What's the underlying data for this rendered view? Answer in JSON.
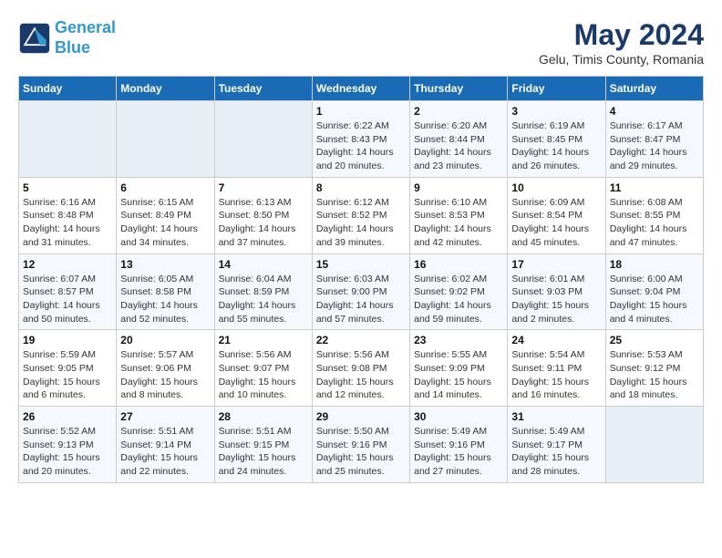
{
  "header": {
    "logo_line1": "General",
    "logo_line2": "Blue",
    "month": "May 2024",
    "location": "Gelu, Timis County, Romania"
  },
  "weekdays": [
    "Sunday",
    "Monday",
    "Tuesday",
    "Wednesday",
    "Thursday",
    "Friday",
    "Saturday"
  ],
  "weeks": [
    [
      {
        "day": "",
        "info": ""
      },
      {
        "day": "",
        "info": ""
      },
      {
        "day": "",
        "info": ""
      },
      {
        "day": "1",
        "info": "Sunrise: 6:22 AM\nSunset: 8:43 PM\nDaylight: 14 hours\nand 20 minutes."
      },
      {
        "day": "2",
        "info": "Sunrise: 6:20 AM\nSunset: 8:44 PM\nDaylight: 14 hours\nand 23 minutes."
      },
      {
        "day": "3",
        "info": "Sunrise: 6:19 AM\nSunset: 8:45 PM\nDaylight: 14 hours\nand 26 minutes."
      },
      {
        "day": "4",
        "info": "Sunrise: 6:17 AM\nSunset: 8:47 PM\nDaylight: 14 hours\nand 29 minutes."
      }
    ],
    [
      {
        "day": "5",
        "info": "Sunrise: 6:16 AM\nSunset: 8:48 PM\nDaylight: 14 hours\nand 31 minutes."
      },
      {
        "day": "6",
        "info": "Sunrise: 6:15 AM\nSunset: 8:49 PM\nDaylight: 14 hours\nand 34 minutes."
      },
      {
        "day": "7",
        "info": "Sunrise: 6:13 AM\nSunset: 8:50 PM\nDaylight: 14 hours\nand 37 minutes."
      },
      {
        "day": "8",
        "info": "Sunrise: 6:12 AM\nSunset: 8:52 PM\nDaylight: 14 hours\nand 39 minutes."
      },
      {
        "day": "9",
        "info": "Sunrise: 6:10 AM\nSunset: 8:53 PM\nDaylight: 14 hours\nand 42 minutes."
      },
      {
        "day": "10",
        "info": "Sunrise: 6:09 AM\nSunset: 8:54 PM\nDaylight: 14 hours\nand 45 minutes."
      },
      {
        "day": "11",
        "info": "Sunrise: 6:08 AM\nSunset: 8:55 PM\nDaylight: 14 hours\nand 47 minutes."
      }
    ],
    [
      {
        "day": "12",
        "info": "Sunrise: 6:07 AM\nSunset: 8:57 PM\nDaylight: 14 hours\nand 50 minutes."
      },
      {
        "day": "13",
        "info": "Sunrise: 6:05 AM\nSunset: 8:58 PM\nDaylight: 14 hours\nand 52 minutes."
      },
      {
        "day": "14",
        "info": "Sunrise: 6:04 AM\nSunset: 8:59 PM\nDaylight: 14 hours\nand 55 minutes."
      },
      {
        "day": "15",
        "info": "Sunrise: 6:03 AM\nSunset: 9:00 PM\nDaylight: 14 hours\nand 57 minutes."
      },
      {
        "day": "16",
        "info": "Sunrise: 6:02 AM\nSunset: 9:02 PM\nDaylight: 14 hours\nand 59 minutes."
      },
      {
        "day": "17",
        "info": "Sunrise: 6:01 AM\nSunset: 9:03 PM\nDaylight: 15 hours\nand 2 minutes."
      },
      {
        "day": "18",
        "info": "Sunrise: 6:00 AM\nSunset: 9:04 PM\nDaylight: 15 hours\nand 4 minutes."
      }
    ],
    [
      {
        "day": "19",
        "info": "Sunrise: 5:59 AM\nSunset: 9:05 PM\nDaylight: 15 hours\nand 6 minutes."
      },
      {
        "day": "20",
        "info": "Sunrise: 5:57 AM\nSunset: 9:06 PM\nDaylight: 15 hours\nand 8 minutes."
      },
      {
        "day": "21",
        "info": "Sunrise: 5:56 AM\nSunset: 9:07 PM\nDaylight: 15 hours\nand 10 minutes."
      },
      {
        "day": "22",
        "info": "Sunrise: 5:56 AM\nSunset: 9:08 PM\nDaylight: 15 hours\nand 12 minutes."
      },
      {
        "day": "23",
        "info": "Sunrise: 5:55 AM\nSunset: 9:09 PM\nDaylight: 15 hours\nand 14 minutes."
      },
      {
        "day": "24",
        "info": "Sunrise: 5:54 AM\nSunset: 9:11 PM\nDaylight: 15 hours\nand 16 minutes."
      },
      {
        "day": "25",
        "info": "Sunrise: 5:53 AM\nSunset: 9:12 PM\nDaylight: 15 hours\nand 18 minutes."
      }
    ],
    [
      {
        "day": "26",
        "info": "Sunrise: 5:52 AM\nSunset: 9:13 PM\nDaylight: 15 hours\nand 20 minutes."
      },
      {
        "day": "27",
        "info": "Sunrise: 5:51 AM\nSunset: 9:14 PM\nDaylight: 15 hours\nand 22 minutes."
      },
      {
        "day": "28",
        "info": "Sunrise: 5:51 AM\nSunset: 9:15 PM\nDaylight: 15 hours\nand 24 minutes."
      },
      {
        "day": "29",
        "info": "Sunrise: 5:50 AM\nSunset: 9:16 PM\nDaylight: 15 hours\nand 25 minutes."
      },
      {
        "day": "30",
        "info": "Sunrise: 5:49 AM\nSunset: 9:16 PM\nDaylight: 15 hours\nand 27 minutes."
      },
      {
        "day": "31",
        "info": "Sunrise: 5:49 AM\nSunset: 9:17 PM\nDaylight: 15 hours\nand 28 minutes."
      },
      {
        "day": "",
        "info": ""
      }
    ]
  ]
}
